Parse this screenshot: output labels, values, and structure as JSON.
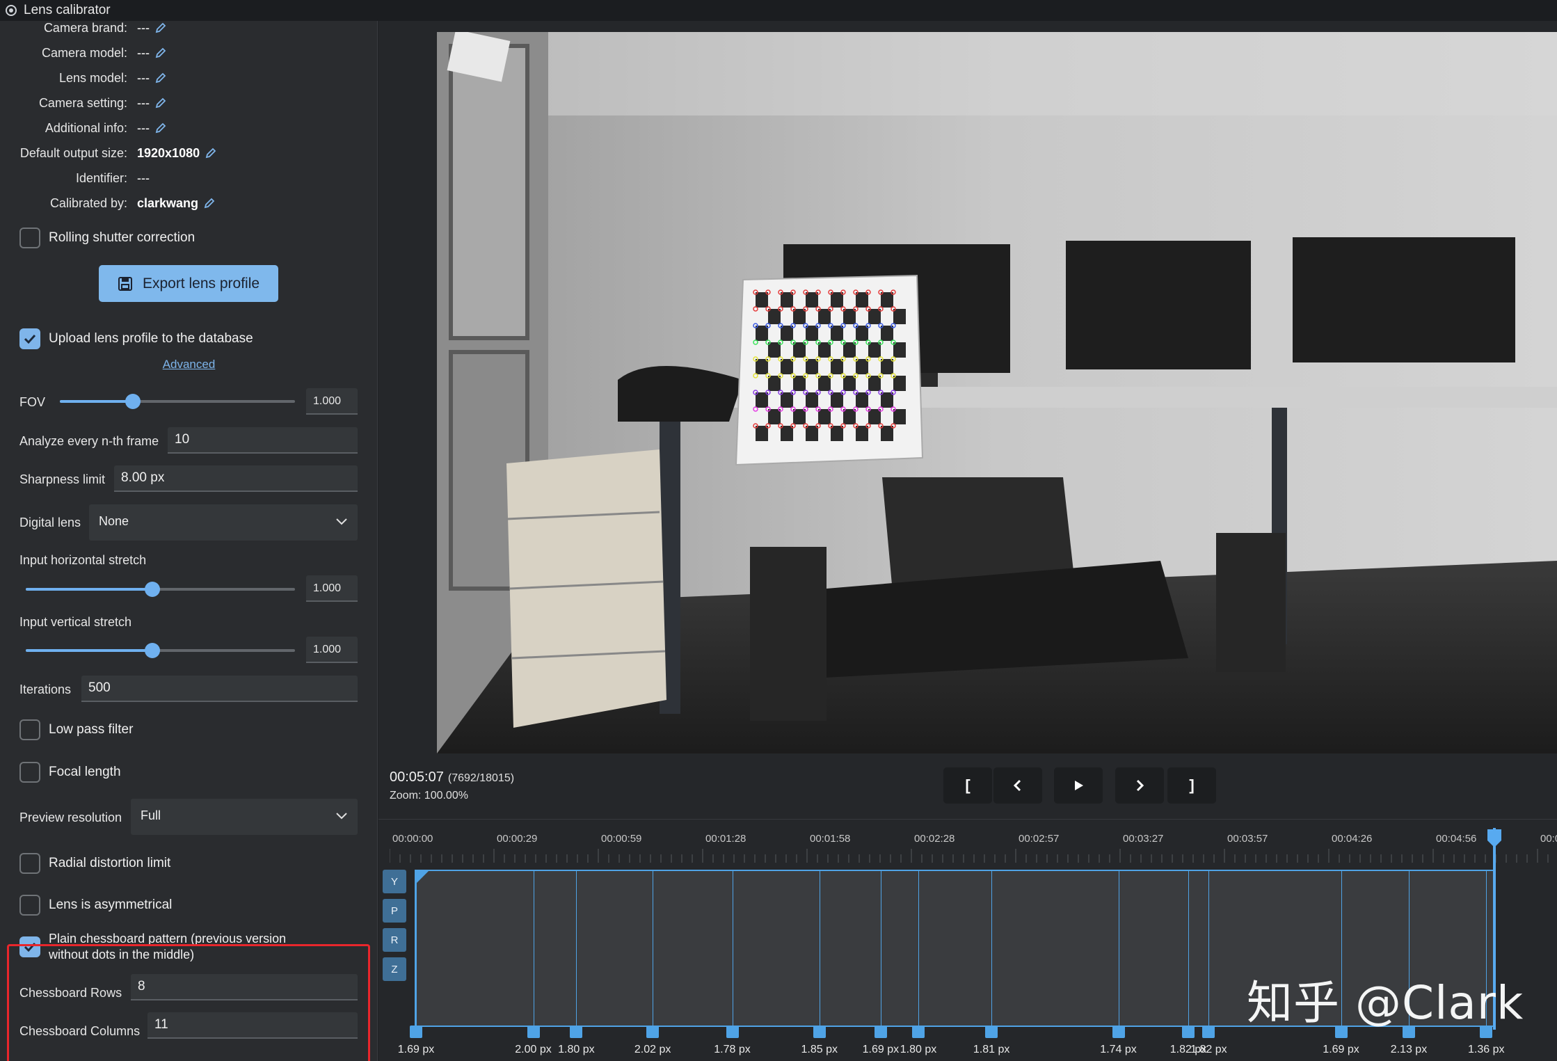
{
  "window": {
    "title": "Lens calibrator"
  },
  "info": [
    {
      "label": "Camera brand:",
      "value": "---",
      "bold": false,
      "editable": true
    },
    {
      "label": "Camera model:",
      "value": "---",
      "bold": false,
      "editable": true
    },
    {
      "label": "Lens model:",
      "value": "---",
      "bold": false,
      "editable": true
    },
    {
      "label": "Camera setting:",
      "value": "---",
      "bold": false,
      "editable": true
    },
    {
      "label": "Additional info:",
      "value": "---",
      "bold": false,
      "editable": true
    },
    {
      "label": "Default output size:",
      "value": "1920x1080",
      "bold": true,
      "editable": true
    },
    {
      "label": "Identifier:",
      "value": "---",
      "bold": false,
      "editable": false
    },
    {
      "label": "Calibrated by:",
      "value": "clarkwang",
      "bold": true,
      "editable": true
    }
  ],
  "options": {
    "rolling_shutter": "Rolling shutter correction",
    "export_label": "Export lens profile",
    "upload_label": "Upload lens profile to the database",
    "advanced_label": "Advanced",
    "fov_label": "FOV",
    "fov_value": "1.000",
    "fov_level": 0.31,
    "nth_frame_label": "Analyze every n-th frame",
    "nth_frame_value": "10",
    "sharpness_label": "Sharpness limit",
    "sharpness_value": "8.00 px",
    "digital_lens_label": "Digital lens",
    "digital_lens_value": "None",
    "h_stretch_label": "Input horizontal stretch",
    "h_stretch_value": "1.000",
    "h_stretch_level": 0.47,
    "v_stretch_label": "Input vertical stretch",
    "v_stretch_value": "1.000",
    "v_stretch_level": 0.47,
    "iterations_label": "Iterations",
    "iterations_value": "500",
    "low_pass_label": "Low pass filter",
    "focal_length_label": "Focal length",
    "preview_res_label": "Preview resolution",
    "preview_res_value": "Full",
    "radial_label": "Radial distortion limit",
    "asym_label": "Lens is asymmetrical",
    "plain_chess_label_1": "Plain chessboard pattern (previous version",
    "plain_chess_label_2": "without dots in the middle)",
    "rows_label": "Chessboard Rows",
    "rows_value": "8",
    "cols_label": "Chessboard Columns",
    "cols_value": "11"
  },
  "playback": {
    "timecode": "00:05:07",
    "frames": "(7692/18015)",
    "zoom": "Zoom: 100.00%",
    "btn_start": "[",
    "btn_end": "]"
  },
  "timeline": {
    "ticks": [
      "00:00:00",
      "00:00:29",
      "00:00:59",
      "00:01:28",
      "00:01:58",
      "00:02:28",
      "00:02:57",
      "00:03:27",
      "00:03:57",
      "00:04:26",
      "00:04:56",
      "00:0"
    ],
    "axes": [
      "Y",
      "P",
      "R",
      "Z"
    ],
    "keyframes": [
      {
        "label": "1.69 px",
        "pos": 0.0
      },
      {
        "label": "2.00 px",
        "pos": 0.109
      },
      {
        "label": "1.80 px",
        "pos": 0.149
      },
      {
        "label": "2.02 px",
        "pos": 0.22
      },
      {
        "label": "1.78 px",
        "pos": 0.294
      },
      {
        "label": "1.85 px",
        "pos": 0.375
      },
      {
        "label": "1.69 px",
        "pos": 0.432
      },
      {
        "label": "1.80 px",
        "pos": 0.467
      },
      {
        "label": "1.81 px",
        "pos": 0.535
      },
      {
        "label": "1.74 px",
        "pos": 0.653
      },
      {
        "label": "1.82 px",
        "pos": 0.718
      },
      {
        "label": "1.82 px",
        "pos": 0.737
      },
      {
        "label": "1.69 px",
        "pos": 0.86
      },
      {
        "label": "2.13 px",
        "pos": 0.923
      },
      {
        "label": "1.36 px",
        "pos": 0.995
      }
    ]
  },
  "watermark": "知乎 @Clark",
  "colors": {
    "accent": "#7fb8ec",
    "highlight": "#e8262c"
  }
}
